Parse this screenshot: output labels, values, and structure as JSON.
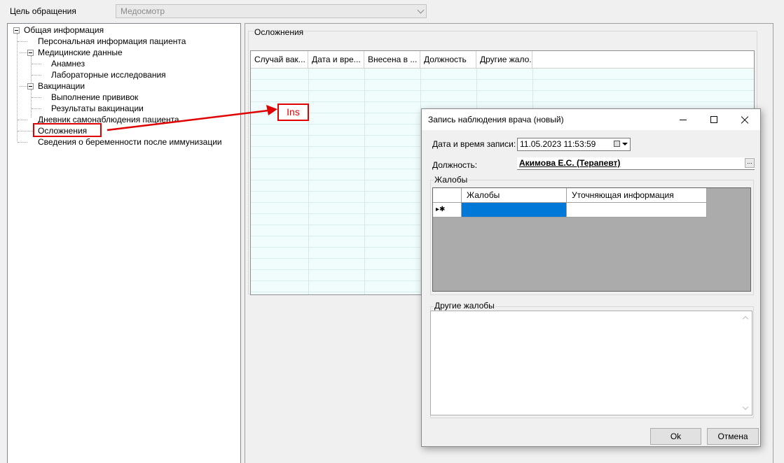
{
  "header": {
    "purpose_label": "Цель обращения",
    "purpose_value": "Медосмотр"
  },
  "tree": {
    "items": [
      {
        "label": "Общая информация"
      },
      {
        "label": "Персональная информация пациента"
      },
      {
        "label": "Медицинские данные"
      },
      {
        "label": "Анамнез"
      },
      {
        "label": "Лабораторные исследования"
      },
      {
        "label": "Вакцинации"
      },
      {
        "label": "Выполнение прививок"
      },
      {
        "label": "Результаты вакцинации"
      },
      {
        "label": "Дневник самонаблюдения пациента"
      },
      {
        "label": "Осложнения"
      },
      {
        "label": "Сведения о беременности после иммунизации"
      }
    ]
  },
  "complications": {
    "title": "Осложнения",
    "columns": [
      "Случай вак...",
      "Дата и вре...",
      "Внесена в ...",
      "Должность",
      "Другие жало..."
    ]
  },
  "annotation": {
    "key_label": "Ins",
    "highlight_color": "#e00000"
  },
  "dialog": {
    "title": "Запись наблюдения врача (новый)",
    "datetime_label": "Дата и время записи:",
    "datetime_value": "11.05.2023 11:53:59",
    "position_label": "Должность:",
    "position_value": "Акимова Е.С. (Терапевт)",
    "position_browse": "...",
    "complaints_group": "Жалобы",
    "complaints_columns": [
      "Жалобы",
      "Уточняющая информация"
    ],
    "new_row_marker": "▸✱",
    "selected_cell_color": "#0078d7",
    "other_complaints_group": "Другие жалобы",
    "ok_label": "Ok",
    "cancel_label": "Отмена"
  }
}
